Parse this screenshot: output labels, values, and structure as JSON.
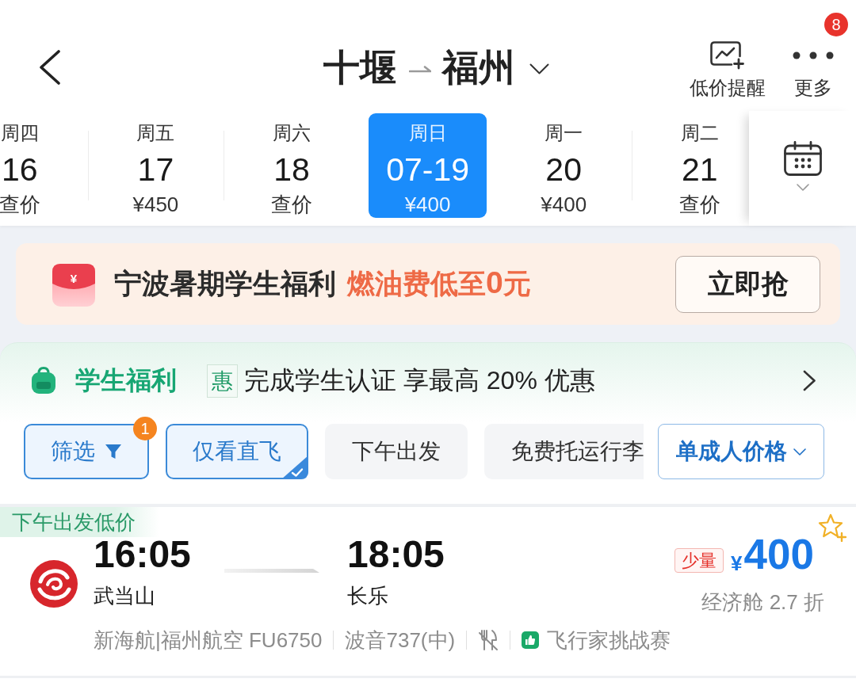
{
  "header": {
    "origin": "十堰",
    "destination": "福州",
    "alert_label": "低价提醒",
    "more_label": "更多",
    "more_badge": "8"
  },
  "dates": [
    {
      "weekday": "周四",
      "day": "16",
      "price": "查价",
      "selected": false
    },
    {
      "weekday": "周五",
      "day": "17",
      "price": "¥450",
      "selected": false
    },
    {
      "weekday": "周六",
      "day": "18",
      "price": "查价",
      "selected": false
    },
    {
      "weekday": "周日",
      "day": "07-19",
      "price": "¥400",
      "selected": true
    },
    {
      "weekday": "周一",
      "day": "20",
      "price": "¥400",
      "selected": false
    },
    {
      "weekday": "周二",
      "day": "21",
      "price": "查价",
      "selected": false
    }
  ],
  "promo_banner": {
    "icon_symbol": "¥",
    "title": "宁波暑期学生福利",
    "highlight": "燃油费低至**0**元",
    "button": "立即抢"
  },
  "student_benefit": {
    "title": "学生福利",
    "tag": "惠",
    "text": "完成学生认证 享最高 20% 优惠"
  },
  "filters": [
    {
      "kind": "filter",
      "label": "筛选",
      "badge": "1",
      "selected": true
    },
    {
      "kind": "toggle",
      "label": "仅看直飞",
      "selected": true
    },
    {
      "kind": "toggle",
      "label": "下午出发",
      "selected": false
    },
    {
      "kind": "toggle",
      "label": "免费托运行李",
      "selected": false
    }
  ],
  "price_mode": {
    "label": "单成人价格"
  },
  "flights": [
    {
      "tag": "下午出发低价",
      "depart_time": "16:05",
      "depart_airport": "武当山",
      "arrive_time": "18:05",
      "arrive_airport": "长乐",
      "stock_tag": "少量",
      "currency": "¥",
      "price": "400",
      "cabin": "经济舱 2.7 折",
      "airline": "新海航|福州航空 FU6750",
      "aircraft": "波音737(中)",
      "promo": "飞行家挑战赛"
    }
  ]
}
